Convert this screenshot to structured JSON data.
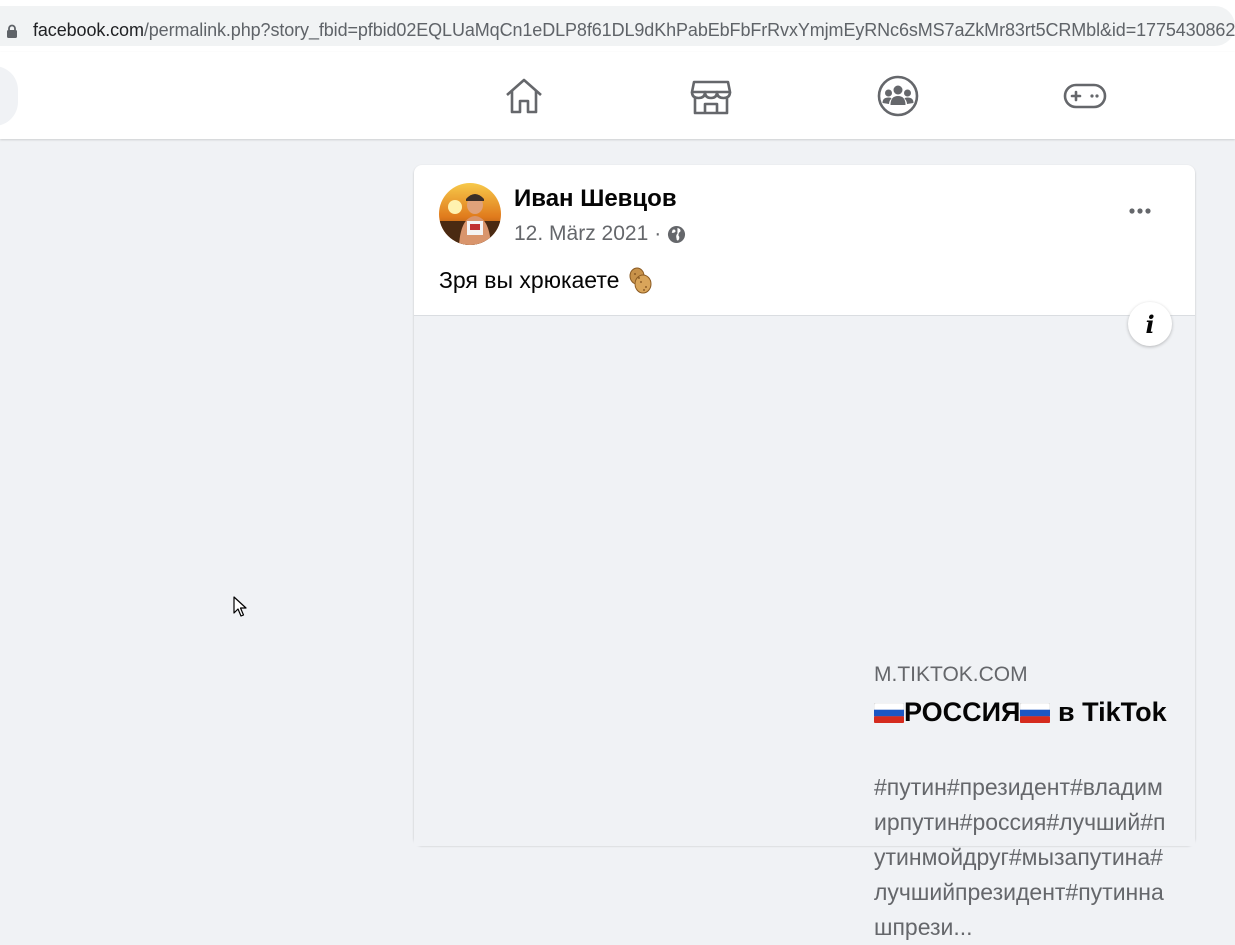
{
  "browser": {
    "url_host": "facebook.com",
    "url_path": "/permalink.php?story_fbid=pfbid02EQLUaMqCn1eDLP8f61DL9dKhPabEbFbFrRvxYmjmEyRNc6sMS7aZkMr83rt5CRMbl&id=1775430862"
  },
  "nav": {
    "icons": [
      "home-icon",
      "marketplace-icon",
      "groups-icon",
      "gaming-icon"
    ]
  },
  "post": {
    "author": "Иван Шевцов",
    "date": "12. März 2021",
    "separator": "·",
    "text": "Зря вы хрюкаете",
    "link_preview": {
      "domain": "M.TIKTOK.COM",
      "title_main": "РОССИЯ",
      "title_rest": " в TikTok",
      "description": "#путин#президент#владимирпутин#россия#лучший#путинмойдруг#мызапутина#лучшийпрезидент#путиннашпрези...",
      "info_label": "i"
    }
  },
  "colors": {
    "background": "#f0f2f5",
    "text_primary": "#050505",
    "text_secondary": "#65676b",
    "icon_gray": "#65676b"
  }
}
